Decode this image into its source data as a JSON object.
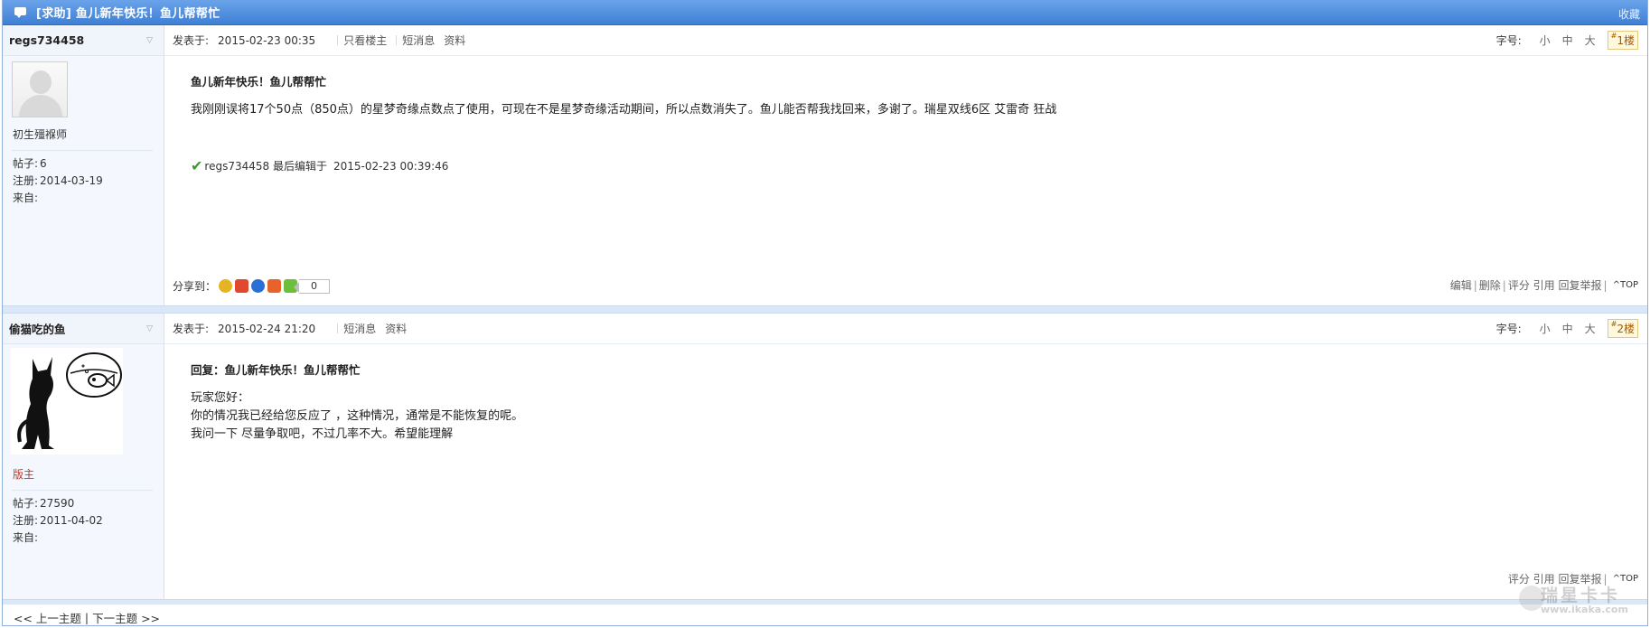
{
  "thread": {
    "title": "[求助] 鱼儿新年快乐！鱼儿帮帮忙",
    "favorite_label": "收藏"
  },
  "labels": {
    "posted_at": "发表于:",
    "only_op": "只看楼主",
    "short_msg": "短消息",
    "profile": "资料",
    "font_size": "字号:",
    "size_small": "小",
    "size_medium": "中",
    "size_large": "大",
    "share_to": "分享到：",
    "posts": "帖子:",
    "registered": "注册:",
    "from": "来自:",
    "edit": "编辑",
    "delete": "删除",
    "rate": "评分",
    "quote": "引用",
    "reply": "回复",
    "report": "举报",
    "top": "TOP",
    "separator": "|"
  },
  "posts": [
    {
      "username": "regs734458",
      "rank": "初生殭褓师",
      "post_count": "6",
      "register_date": "2014-03-19",
      "from": "",
      "posted_date": "2015-02-23 00:35",
      "floor": "1楼",
      "subject": "鱼儿新年快乐！鱼儿帮帮忙",
      "message": "我刚刚误将17个50点（850点）的星梦奇缘点数点了使用，可现在不是星梦奇缘活动期间，所以点数消失了。鱼儿能否帮我找回来，多谢了。瑞星双线6区 艾雷奇 狂战",
      "edited_by": "regs734458 最后编辑于",
      "edited_time": "2015-02-23 00:39:46",
      "share_count": "0"
    },
    {
      "username": "偷猫吃的鱼",
      "rank": "版主",
      "post_count": "27590",
      "register_date": "2011-04-02",
      "from": "",
      "posted_date": "2015-02-24 21:20",
      "floor": "2楼",
      "subject": "回复：鱼儿新年快乐！鱼儿帮帮忙",
      "lines": [
        "玩家您好：",
        "你的情况我已经给您反应了 ，这种情况，通常是不能恢复的呢。",
        "我问一下  尽量争取吧，不过几率不大。希望能理解"
      ]
    }
  ],
  "navigation": {
    "prev": "<< 上一主题",
    "sep": "|",
    "next": "下一主题 >>"
  },
  "watermark": {
    "brand": "瑞星卡卡",
    "url": "www.ikaka.com"
  },
  "colors": {
    "title_bar": "#3f80d6",
    "sidebar_bg": "#f4f7fd",
    "moderator": "#c0392b",
    "floor_bg": "#fff8dc"
  }
}
